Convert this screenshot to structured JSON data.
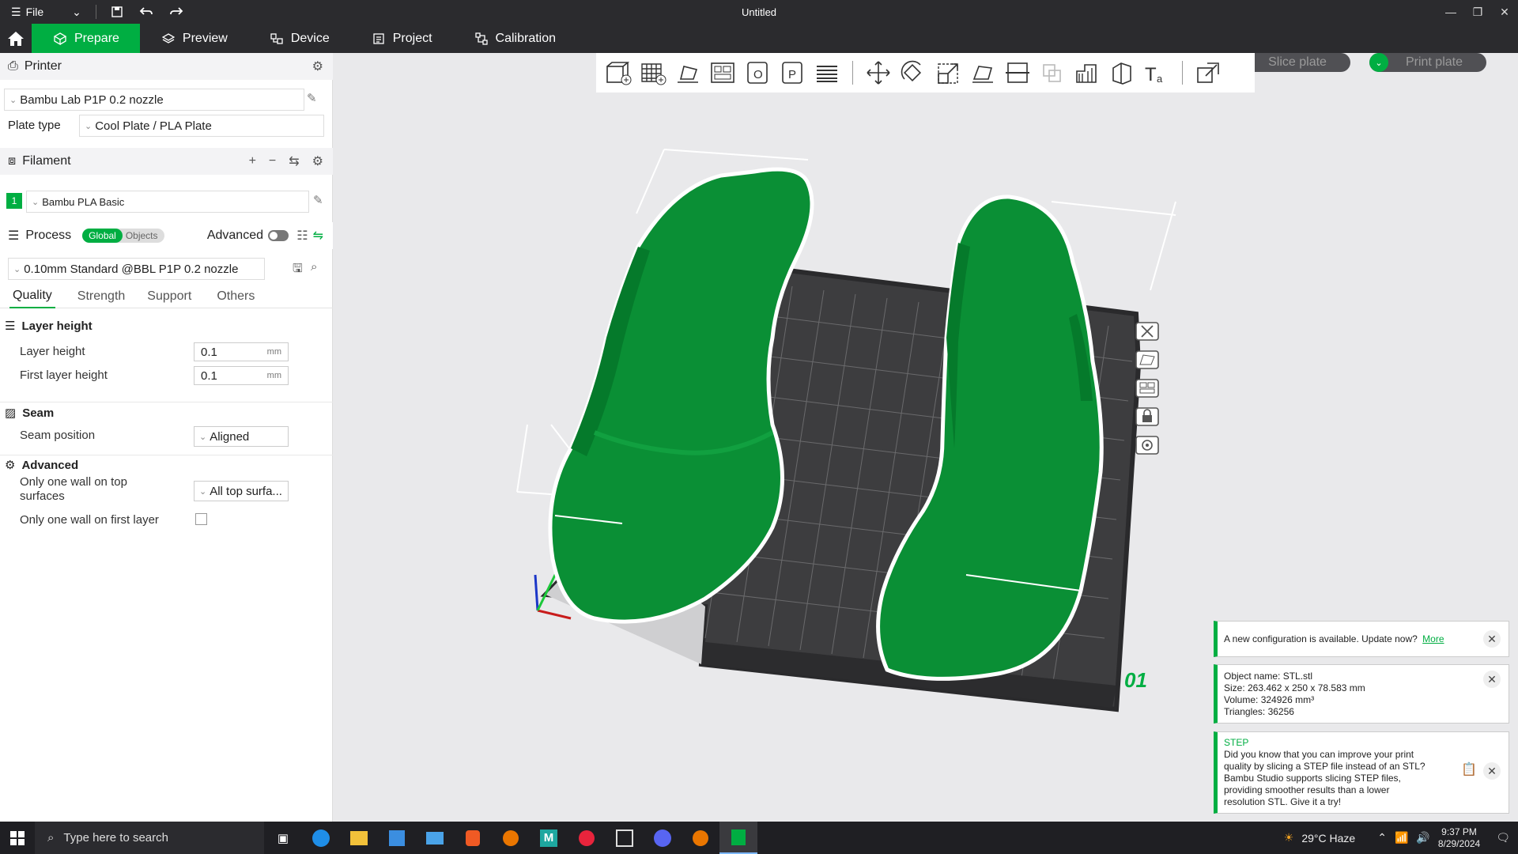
{
  "titlebar": {
    "menu_label": "File",
    "title": "Untitled"
  },
  "menubar": {
    "tabs": [
      {
        "label": "Prepare"
      },
      {
        "label": "Preview"
      },
      {
        "label": "Device"
      },
      {
        "label": "Project"
      },
      {
        "label": "Calibration"
      }
    ],
    "slice_plate": "Slice plate",
    "print_plate": "Print plate"
  },
  "sidebar": {
    "printer": {
      "title": "Printer",
      "preset": "Bambu Lab P1P 0.2 nozzle",
      "plate_type_label": "Plate type",
      "plate_type_value": "Cool Plate / PLA Plate"
    },
    "filament": {
      "title": "Filament",
      "slot_number": "1",
      "slot_color": "#00ae42",
      "preset": "Bambu PLA Basic"
    },
    "process": {
      "title": "Process",
      "global_label": "Global",
      "objects_label": "Objects",
      "advanced_label": "Advanced",
      "preset": "0.10mm Standard @BBL P1P 0.2 nozzle"
    },
    "tabs": [
      "Quality",
      "Strength",
      "Support",
      "Others"
    ],
    "groups": {
      "layer_height": {
        "title": "Layer height",
        "layer_height_label": "Layer height",
        "layer_height_value": "0.1",
        "first_layer_label": "First layer height",
        "first_layer_value": "0.1",
        "unit": "mm"
      },
      "seam": {
        "title": "Seam",
        "seam_position_label": "Seam position",
        "seam_position_value": "Aligned"
      },
      "advanced": {
        "title": "Advanced",
        "one_wall_top_label_1": "Only one wall on top",
        "one_wall_top_label_2": "surfaces",
        "one_wall_top_value": "All top surfa...",
        "one_wall_first_label": "Only one wall on first layer"
      }
    }
  },
  "plate": {
    "number": "01",
    "model_color": "#0a8f35"
  },
  "notifications": {
    "update": {
      "text": "A new configuration is available. Update now?",
      "link": "More"
    },
    "object_info": {
      "name": "Object name: STL.stl",
      "size": "Size: 263.462 x 250 x 78.583 mm",
      "volume": "Volume: 324926 mm³",
      "triangles": "Triangles: 36256"
    },
    "step": {
      "title": "STEP",
      "line1": "Did you know that you can improve your print",
      "line2": "quality by slicing a STEP file instead of an STL?",
      "line3": "Bambu Studio supports slicing STEP files,",
      "line4": "providing smoother results than a lower",
      "line5": "resolution STL. Give it a try!"
    }
  },
  "taskbar": {
    "search_placeholder": "Type here to search",
    "weather": "29°C  Haze",
    "time": "9:37 PM",
    "date": "8/29/2024"
  }
}
